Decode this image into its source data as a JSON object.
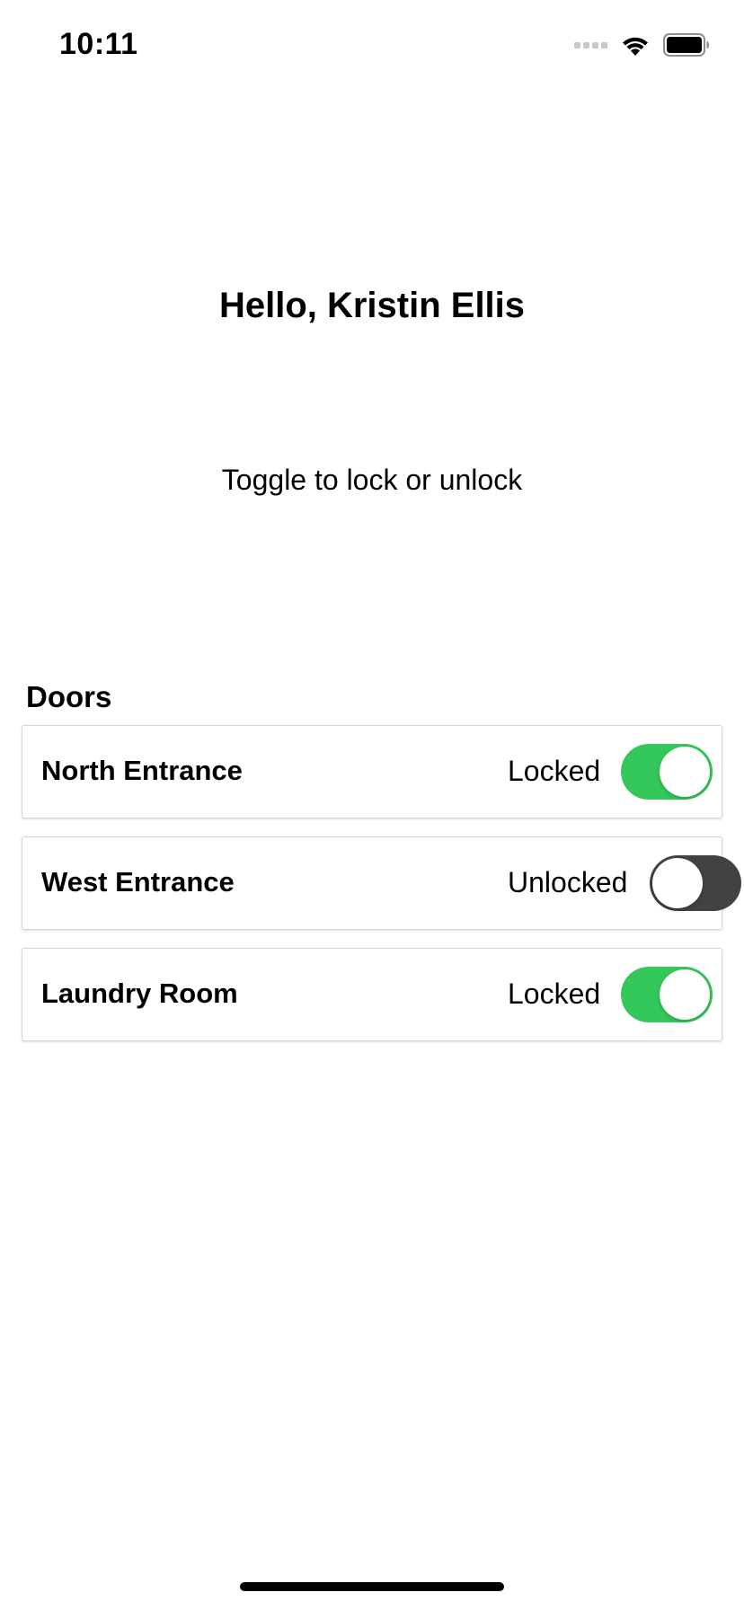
{
  "status_bar": {
    "time": "10:11",
    "icons": [
      "signal-icon",
      "wifi-icon",
      "battery-icon"
    ]
  },
  "greeting": "Hello, Kristin Ellis",
  "instruction": "Toggle to lock or unlock",
  "doors": {
    "title": "Doors",
    "items": [
      {
        "name": "North Entrance",
        "status": "Locked",
        "locked": true
      },
      {
        "name": "West Entrance",
        "status": "Unlocked",
        "locked": false
      },
      {
        "name": "Laundry Room",
        "status": "Locked",
        "locked": true
      }
    ]
  },
  "colors": {
    "toggle_on": "#34c759",
    "toggle_off": "#424245"
  }
}
